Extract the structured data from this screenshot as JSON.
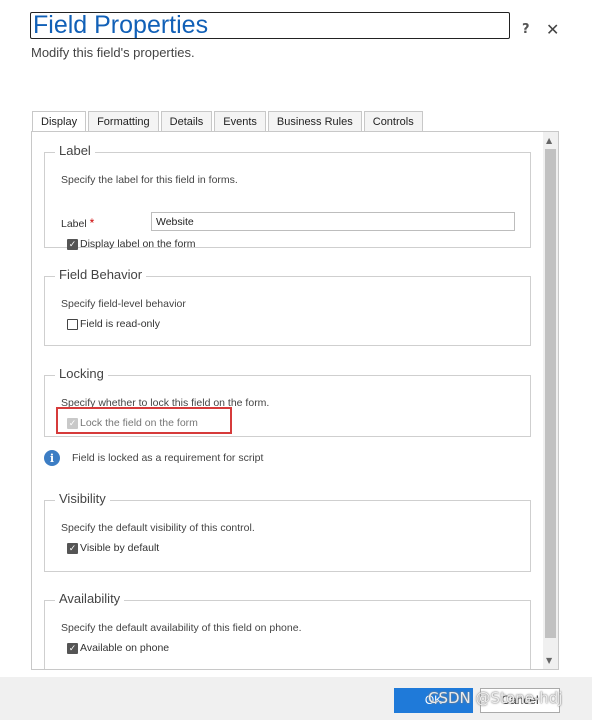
{
  "dialog": {
    "title": "Field Properties",
    "subtitle": "Modify this field's properties.",
    "help_label": "?",
    "close_label": "✕"
  },
  "tabs": [
    {
      "label": "Display",
      "active": true
    },
    {
      "label": "Formatting"
    },
    {
      "label": "Details"
    },
    {
      "label": "Events"
    },
    {
      "label": "Business Rules"
    },
    {
      "label": "Controls"
    }
  ],
  "sections": {
    "label": {
      "title": "Label",
      "description": "Specify the label for this field in forms.",
      "field_label": "Label",
      "required_mark": "*",
      "field_value": "Website",
      "display_label_text": "Display label on the form",
      "display_label_checked": true
    },
    "behavior": {
      "title": "Field Behavior",
      "description": "Specify field-level behavior",
      "readonly_text": "Field is read-only",
      "readonly_checked": false
    },
    "locking": {
      "title": "Locking",
      "description": "Specify whether to lock this field on the form.",
      "lock_text": "Lock the field on the form",
      "lock_checked": true,
      "lock_disabled": true,
      "info_text": "Field is locked as a requirement for script"
    },
    "visibility": {
      "title": "Visibility",
      "description": "Specify the default visibility of this control.",
      "visible_text": "Visible by default",
      "visible_checked": true
    },
    "availability": {
      "title": "Availability",
      "description": "Specify the default availability of this field on phone.",
      "phone_text": "Available on phone",
      "phone_checked": true
    }
  },
  "footer": {
    "ok_label": "OK",
    "cancel_label": "Cancel"
  },
  "watermark": "CSDN @Stone-hdj",
  "colors": {
    "title": "#1160b7",
    "ok_button": "#1f7ad9",
    "highlight": "#d63b3b",
    "info_icon": "#3c7dc4"
  }
}
